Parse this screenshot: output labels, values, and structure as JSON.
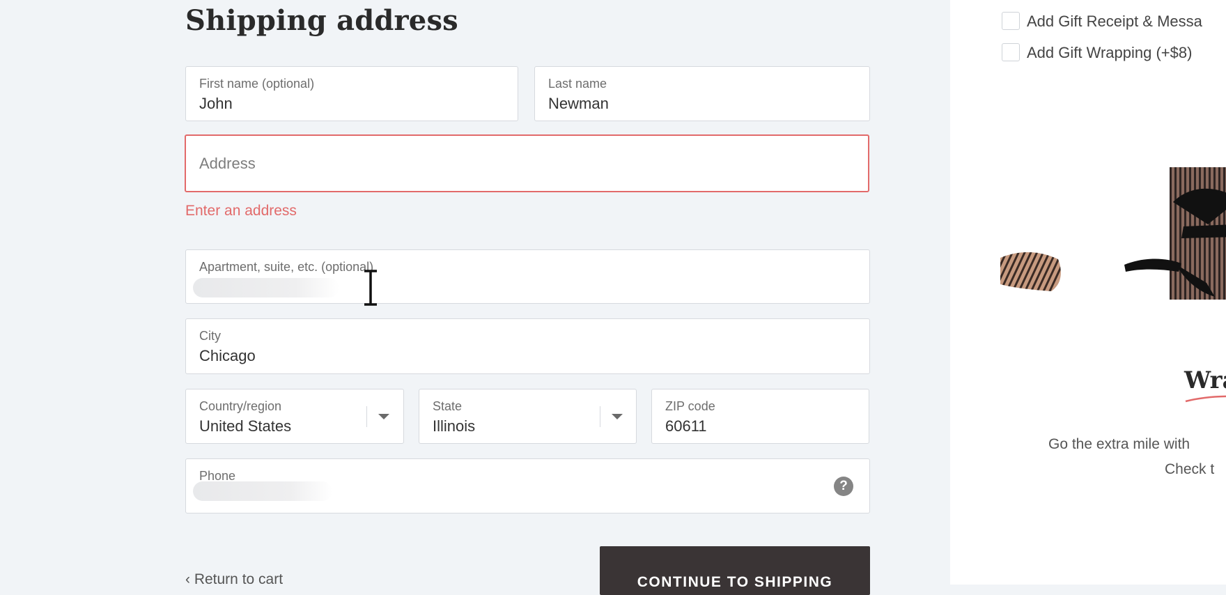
{
  "shipping": {
    "title": "Shipping address",
    "first_name": {
      "label": "First name (optional)",
      "value": "John"
    },
    "last_name": {
      "label": "Last name",
      "value": "Newman"
    },
    "address": {
      "placeholder": "Address",
      "error": "Enter an address"
    },
    "apartment": {
      "label": "Apartment, suite, etc. (optional)"
    },
    "city": {
      "label": "City",
      "value": "Chicago"
    },
    "country": {
      "label": "Country/region",
      "value": "United States"
    },
    "state": {
      "label": "State",
      "value": "Illinois"
    },
    "zip": {
      "label": "ZIP code",
      "value": "60611"
    },
    "phone": {
      "label": "Phone",
      "help_icon": "?"
    }
  },
  "nav": {
    "return_label": "‹ Return to cart",
    "continue_label": "CONTINUE TO SHIPPING"
  },
  "sidebar": {
    "options": [
      {
        "label": "Add Gift Receipt & Messa"
      },
      {
        "label": "Add Gift Wrapping (+$8)"
      }
    ],
    "heading": "Wra",
    "promo_line1": "Go the extra mile with",
    "promo_line2": "Check t"
  },
  "colors": {
    "error": "#e26a6a",
    "button": "#3a3435",
    "background": "#f1f4f7"
  },
  "icons": {
    "help": "help-circle-icon",
    "cursor": "text-cursor-icon",
    "caret": "chevron-down-icon"
  }
}
